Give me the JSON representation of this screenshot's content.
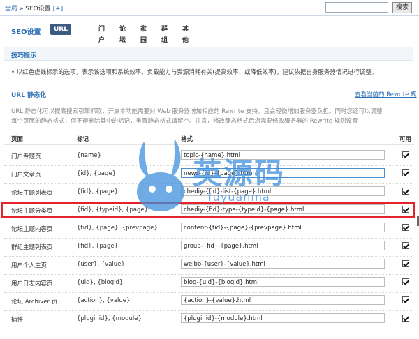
{
  "breadcrumb": {
    "root": "全局",
    "sep": "»",
    "current": "SEO设置",
    "add": "[+]"
  },
  "search": {
    "value": "",
    "button": "搜索"
  },
  "nav": {
    "title": "SEO设置",
    "tabs": [
      {
        "label": "URL 静态化",
        "active": true
      },
      {
        "label": "门户"
      },
      {
        "label": "论坛"
      },
      {
        "label": "家园"
      },
      {
        "label": "群组"
      },
      {
        "label": "其他"
      }
    ]
  },
  "tips": {
    "title": "技巧提示",
    "text": "• 以红色虚线标示的选项，表示该选项和系统效率、负载能力与资源消耗有关(提高效率、或降低效率)，建议依据自身服务器情况进行调整。"
  },
  "url_section": {
    "title": "URL 静态化",
    "link": "查看当前的 Rewrite 规",
    "desc_line1": "URL 静态化可以提高搜索引擎抓取，开启本功能需要对 Web 服务器增加相应的 Rewrite 支持，且会轻微增加服务器负担。同时您还可以调整",
    "desc_line2": "每个页面的静态格式，但不得删除其中的标记，重置静态格式请留空。注意，修改静态格式后您需要修改服务器的 Rewrite 规则设置"
  },
  "table": {
    "headers": {
      "page": "页面",
      "mark": "标记",
      "format": "格式",
      "enabled": "可用"
    },
    "rows": [
      {
        "page": "门户专题页",
        "mark": "{name}",
        "format": "topic-{name}.html",
        "enabled": true
      },
      {
        "page": "门户文章页",
        "mark": "{id}, {page}",
        "format": "news-{id}-{page}.html",
        "enabled": true,
        "focus": true
      },
      {
        "page": "论坛主题列表页",
        "mark": "{fid}, {page}",
        "format": "chediy-{fid}-list-{page}.html",
        "enabled": true
      },
      {
        "page": "论坛主题分类页",
        "mark": "{fid}, {typeid}, {page}",
        "format": "chediy-{fid}-type-{typeid}-{page}.html",
        "enabled": true
      },
      {
        "page": "论坛主题内容页",
        "mark": "{tid}, {page}, {prevpage}",
        "format": "content-{tid}-{page}-{prevpage}.html",
        "enabled": true
      },
      {
        "page": "群组主题列表页",
        "mark": "{fid}, {page}",
        "format": "group-{fid}-{page}.html",
        "enabled": true
      },
      {
        "page": "用户个人主页",
        "mark": "{user}, {value}",
        "format": "weibo-{user}-{value}.html",
        "enabled": true
      },
      {
        "page": "用户日志内容页",
        "mark": "{uid}, {blogid}",
        "format": "blog-{uid}-{blogid}.html",
        "enabled": true
      },
      {
        "page": "论坛 Archiver 页",
        "mark": "{action}, {value}",
        "format": "{action}-{value}.html",
        "enabled": true
      },
      {
        "page": "插件",
        "mark": "{pluginid}, {module}",
        "format": "{pluginid}-{module}.html",
        "enabled": true
      }
    ]
  },
  "watermark": {
    "main": "英源码",
    "sub": "fuyuanma"
  },
  "colors": {
    "accent": "#2b6fb5",
    "highlight": "#e2232a",
    "tab_active": "#3d5a80"
  }
}
